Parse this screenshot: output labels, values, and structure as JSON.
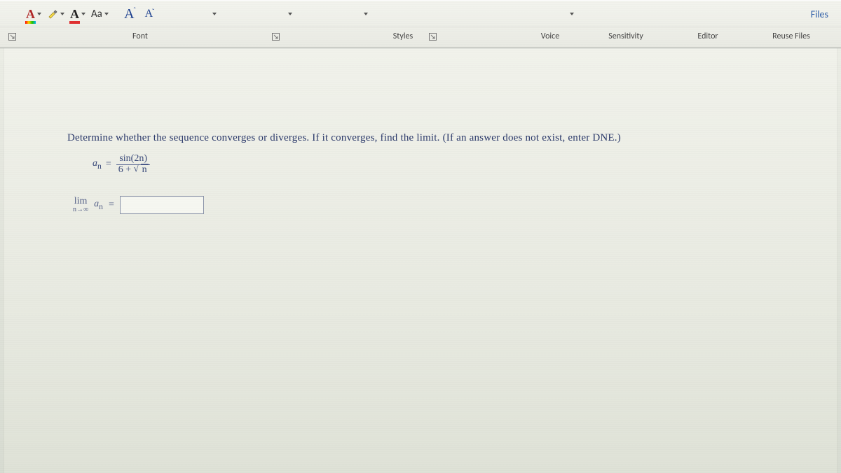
{
  "ribbon": {
    "files_label": "Files",
    "font_color_btn": "A",
    "text_color_btn": "A",
    "change_case_label": "Aa",
    "grow_font_label": "A",
    "shrink_font_label": "A",
    "groups": {
      "font": "Font",
      "styles": "Styles",
      "voice": "Voice",
      "sensitivity": "Sensitivity",
      "editor": "Editor",
      "reuse": "Reuse Files"
    }
  },
  "question": {
    "text": "Determine whether the sequence converges or diverges. If it converges, find the limit. (If an answer does not exist, enter DNE.)"
  },
  "formula": {
    "lhs_var": "a",
    "lhs_sub": "n",
    "eq": "=",
    "num": "sin(2n)",
    "den_left": "6 +",
    "den_radicand": "n"
  },
  "limit": {
    "top": "lim",
    "bot": "n→∞",
    "var": "a",
    "sub": "n",
    "eq": "=",
    "value": ""
  }
}
